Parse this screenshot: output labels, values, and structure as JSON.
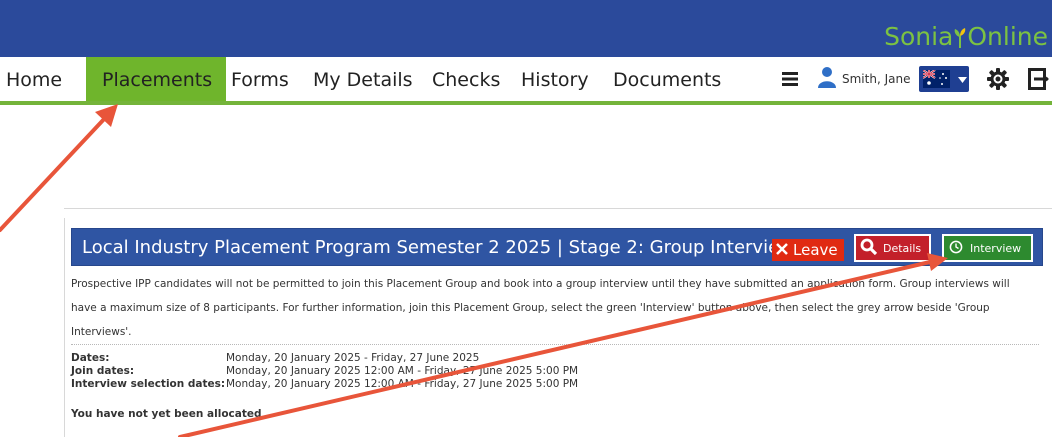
{
  "brand": {
    "part1": "Sonia",
    "part2": "Online"
  },
  "nav": {
    "items": [
      "Home",
      "Placements",
      "Forms",
      "My Details",
      "Checks",
      "History",
      "Documents"
    ],
    "active": "Placements",
    "user_name": "Smith, Jane"
  },
  "panel": {
    "title": "Local Industry Placement Program Semester 2 2025 | Stage 2: Group Interview",
    "leave_label": "Leave",
    "details_label": "Details",
    "interview_label": "Interview",
    "description_lines": [
      "Prospective IPP candidates will not be permitted to join this Placement Group and book into a group interview until they have submitted an application form. Group interviews will",
      "have a maximum size of 8 participants. For further information, join this Placement Group, select the green 'Interview' button above, then select the grey arrow beside 'Group",
      "Interviews'."
    ],
    "info": [
      {
        "label": "Dates:",
        "value": "Monday, 20 January 2025 - Friday, 27 June 2025"
      },
      {
        "label": "Join dates:",
        "value": "Monday, 20 January 2025 12:00 AM - Friday, 27 June 2025 5:00 PM"
      },
      {
        "label": "Interview selection dates:",
        "value": "Monday, 20 January 2025 12:00 AM - Friday, 27 June 2025 5:00 PM"
      }
    ],
    "allocation_status": "You have not yet been allocated"
  },
  "colors": {
    "banner": "#2b4a9b",
    "nav_active": "#6fb52c",
    "panel_header": "#2f55a3",
    "leave": "#e02a12",
    "details": "#c3202a",
    "interview": "#2d8a2f",
    "annotation_arrow": "#e8553a"
  },
  "icons": {
    "menu": "hamburger-icon",
    "user": "user-icon",
    "flag": "australia-flag-icon",
    "settings": "gear-icon",
    "logout": "logout-icon",
    "leave": "close-icon",
    "details": "search-icon",
    "interview": "clock-icon"
  }
}
